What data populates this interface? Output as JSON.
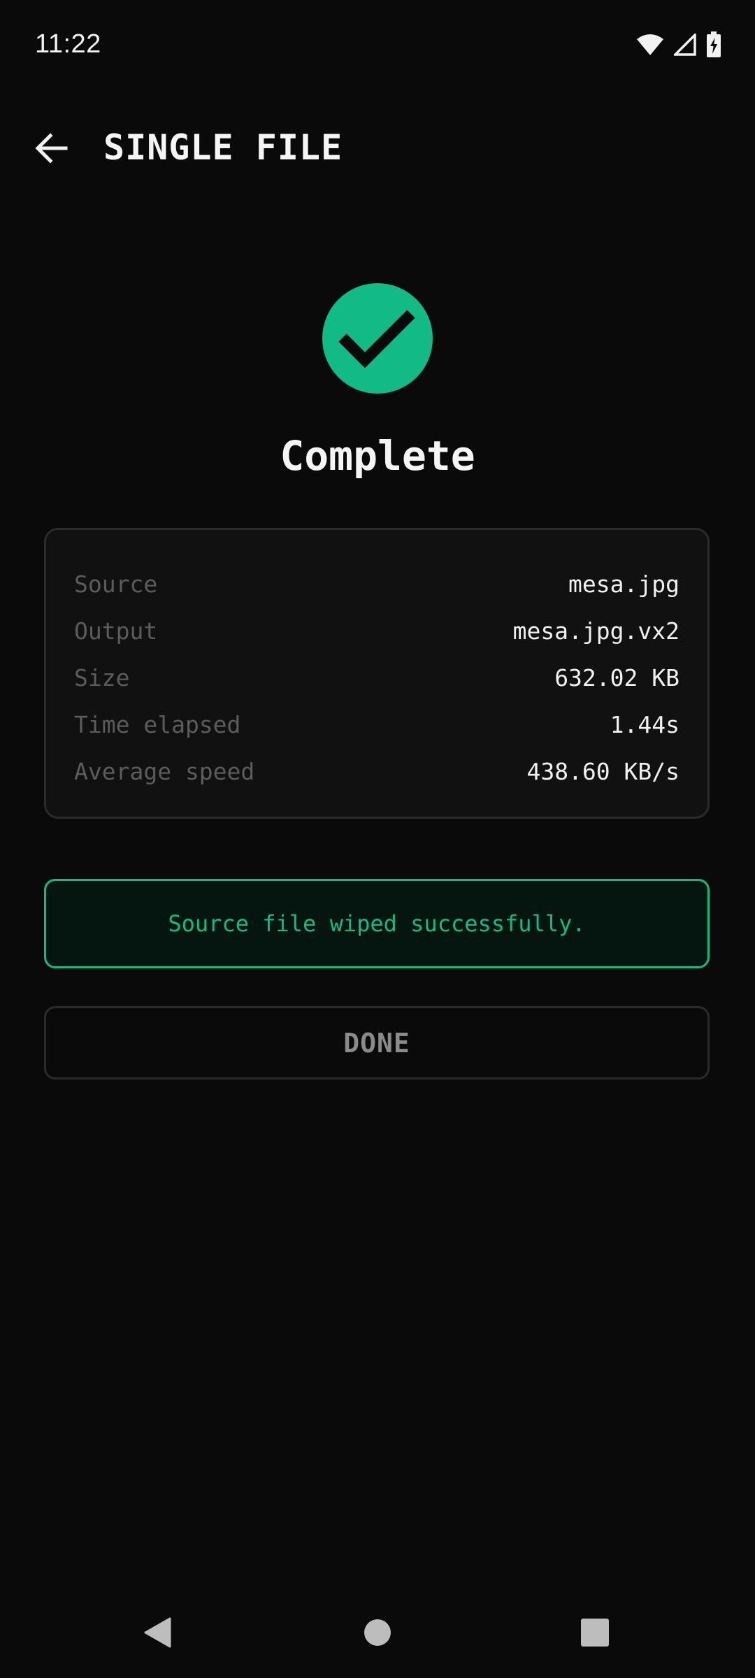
{
  "status_bar": {
    "time": "11:22",
    "icons": [
      "wifi-icon",
      "signal-icon",
      "battery-charging-icon"
    ]
  },
  "app_bar": {
    "back_icon": "arrow-back-icon",
    "title": "SINGLE FILE"
  },
  "result": {
    "icon": "check-circle-icon",
    "title": "Complete"
  },
  "details": {
    "rows": [
      {
        "label": "Source",
        "value": "mesa.jpg"
      },
      {
        "label": "Output",
        "value": "mesa.jpg.vx2"
      },
      {
        "label": "Size",
        "value": "632.02 KB"
      },
      {
        "label": "Time elapsed",
        "value": "1.44s"
      },
      {
        "label": "Average speed",
        "value": "438.60 KB/s"
      }
    ]
  },
  "wipe_message": "Source file wiped successfully.",
  "done_button": {
    "label": "DONE"
  },
  "nav_bar": {
    "buttons": [
      "nav-back-icon",
      "nav-home-icon",
      "nav-recents-icon"
    ]
  },
  "colors": {
    "background": "#0a0a0a",
    "accent": "#12bb86",
    "card": "#111111",
    "border": "#2b2b2b",
    "muted_text": "#5c5c5c"
  }
}
